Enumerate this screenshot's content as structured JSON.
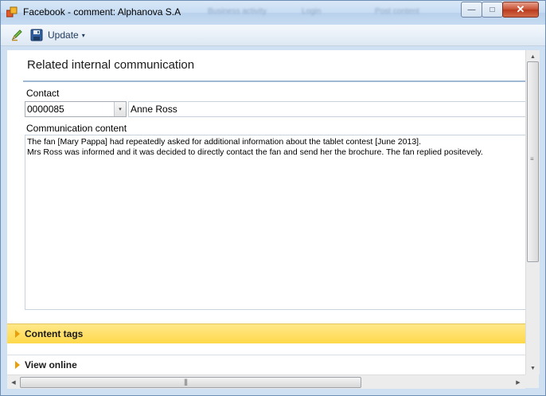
{
  "window": {
    "title": "Facebook - comment: Alphanova S.A",
    "background_tabs": [
      "Business activity",
      "Login",
      "Post content"
    ],
    "controls": {
      "minimize": "—",
      "maximize": "□",
      "close": "✕"
    }
  },
  "toolbar": {
    "edit_icon": "pencil-icon",
    "save_icon": "save-disk-icon",
    "update_label": "Update",
    "update_caret": "▾"
  },
  "section": {
    "title": "Related internal communication"
  },
  "contact": {
    "label": "Contact",
    "id_value": "0000085",
    "name_value": "Anne Ross"
  },
  "communication": {
    "label": "Communication content",
    "lines": [
      "The fan [Mary Pappa] had repeatedly asked for additional information about the tablet contest [June 2013].",
      "Mrs Ross was informed and it was decided to directly contact the fan and send her the brochure. The fan replied positevely."
    ]
  },
  "panels": {
    "content_tags": "Content tags",
    "view_online": "View online"
  },
  "colors": {
    "accent_yellow": "#ffd84a",
    "expander_orange": "#e8a00a",
    "title_bar": "#c7dcf3"
  },
  "scrollbars": {
    "up": "▲",
    "down": "▼",
    "left": "◀",
    "right": "▶",
    "v_grip": "≡",
    "h_grip": "|||"
  }
}
